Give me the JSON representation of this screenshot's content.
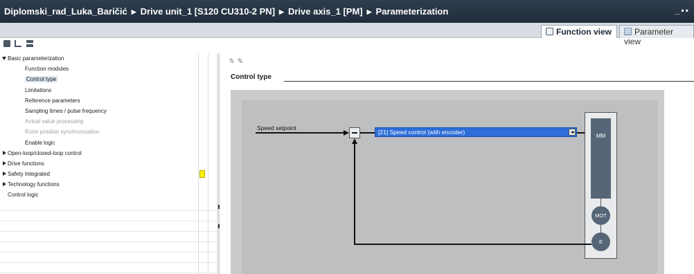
{
  "titlebar": {
    "crumbs": [
      "Diplomski_rad_Luka_Baričić",
      "Drive unit_1 [S120 CU310-2 PN]",
      "Drive axis_1 [PM]",
      "Parameterization"
    ],
    "window_buttons": "_▪▪"
  },
  "tabs": {
    "function_view": "Function view",
    "parameter_view": "Parameter view"
  },
  "tree": {
    "items": [
      {
        "label": "Basic parameterization",
        "level": 1,
        "expanded": true
      },
      {
        "label": "Function modules",
        "level": 2
      },
      {
        "label": "Control type",
        "level": 2,
        "selected": true
      },
      {
        "label": "Limitations",
        "level": 2
      },
      {
        "label": "Reference parameters",
        "level": 2
      },
      {
        "label": "Sampling times / pulse frequency",
        "level": 2
      },
      {
        "label": "Actual value processing",
        "level": 2,
        "disabled": true
      },
      {
        "label": "Rotor position synchronization",
        "level": 2,
        "disabled": true
      },
      {
        "label": "Enable logic",
        "level": 2
      },
      {
        "label": "Open-loop/closed-loop control",
        "level": 1,
        "expanded": false
      },
      {
        "label": "Drive functions",
        "level": 1,
        "expanded": false
      },
      {
        "label": "Safety Integrated",
        "level": 1,
        "expanded": false
      },
      {
        "label": "Technology functions",
        "level": 1,
        "expanded": false
      },
      {
        "label": "Control logic",
        "level": 1,
        "leaf": true
      }
    ]
  },
  "main": {
    "section_title": "Control type",
    "speed_setpoint_label": "Speed setpoint",
    "control_type_selected": "[21] Speed control (with encoder)",
    "blocks": {
      "mm": "MM",
      "mot": "MOT",
      "encoder": "E"
    }
  },
  "colors": {
    "titlebar": "#1f2c3a",
    "dropdown_selected": "#2d6ed8",
    "block_fill": "#566678",
    "status_yellow": "#ffef00"
  },
  "icons": {
    "edit": "pencil-icon",
    "edit2": "pencil-lock-icon",
    "function_view": "function-view-icon",
    "parameter_view": "table-icon"
  }
}
